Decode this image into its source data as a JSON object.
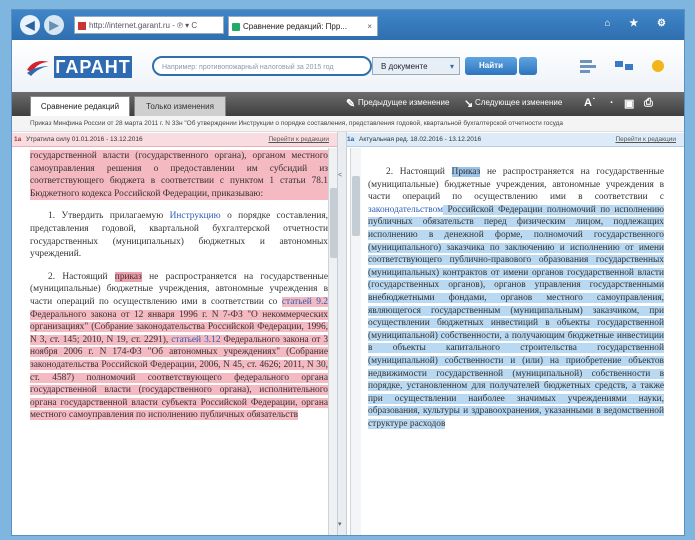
{
  "browser": {
    "address": "http://internet.garant.ru - ℗ ▾ C",
    "tab_title": "Сравнение редакций: Прр...",
    "window_buttons": "⌂ ★ ⚙"
  },
  "header": {
    "logo_text": "ГАРАНТ",
    "search_placeholder": "Например: противопожарный налоговый за 2015 год",
    "scope_value": "В документе",
    "find_button": "Найти"
  },
  "toolbar": {
    "tab_compare": "Сравнение редакций",
    "tab_text": "Только изменения",
    "prev_change": "Предыдущее изменение",
    "next_change": "Следующее изменение"
  },
  "info_line": "Приказ Минфина России от 28 марта 2011 г. N 33н \"Об утверждении Инструкции о порядке составления, представления годовой, квартальной бухгалтерской отчетности госуда",
  "left_edition": {
    "num": "1a",
    "label": "Утратила силу 01.01.2016 - 13.12.2016",
    "action": "Перейти к редакции"
  },
  "right_edition": {
    "num": "1a",
    "label": "Актуальная ред. 18.02.2016 - 13.12.2016",
    "action": "Перейти к редакции"
  },
  "left_text": {
    "p0": "государственной власти (государственного органа), органом местного самоуправления решения о предоставлении им субсидий из соответствующего бюджета в соответствии с пунктом 1 статьи 78.1 Бюджетного кодекса Российской Федерации, приказываю:",
    "p1_a": "1. Утвердить прилагаемую ",
    "p1_link": "Инструкцию",
    "p1_b": " о порядке составления, представления годовой, квартальной бухгалтерской отчетности государственных (муниципальных) бюджетных и автономных учреждений.",
    "p2_a": "2. Настоящий ",
    "p2_word": "приказ",
    "p2_b": " не распространяется на государственные (муниципальные) бюджетные учреждения, автономные учреждения в части операций по осуществлению ими в соответствии со ",
    "p2_link1": "статьей 9.2",
    "p2_c": " Федерального закона от 12 января 1996 г. N 7-ФЗ \"О некоммерческих организациях\" (Собрание законодательства Российской Федерации, 1996, N 3, ст. 145; 2010, N 19, ст. 2291), ",
    "p2_link2": "статьей 3.12",
    "p2_d": " Федерального закона от 3 ноября 2006 г. N 174-ФЗ \"Об автономных учреждениях\" (Собрание законодательства Российской Федерации, 2006, N 45, ст. 4626; 2011, N 30, ст. 4587) полномочий соответствующего федерального органа государственной власти (государственного органа), исполнительного органа государственной власти субъекта Российской Федерации, органа местного самоуправления по исполнению публичных обязательств"
  },
  "right_text": {
    "p0_a": "2. Настоящий ",
    "p0_word": "Приказ",
    "p0_b": " не распространяется на государственные (муниципальные) бюджетные учреждения, автономные учреждения в части операций по осуществлению ими в соответствии с ",
    "p0_link": "законодательством",
    "p0_c": " Российской Федерации полномочий по исполнению публичных обязательств перед физическим лицом, подлежащих исполнению в денежной форме, полномочий государственного (муниципального) заказчика по заключению и исполнению от имени соответствующего публично-правового образования государственных (муниципальных) контрактов от имени органов государственной власти (государственных органов), органов управления государственными внебюджетными фондами, органов местного самоуправления, являющегося государственным (муниципальным) заказчиком, при осуществлении бюджетных инвестиций в объекты государственной (муниципальной) собственности, а получающим бюджетные инвестиции в объекты капитального строительства государственной (муниципальной) собственности и (или) на приобретение объектов недвижимости государственной (муниципальной) собственности в порядке, установленном для получателей бюджетных средств, а также при осуществлении наиболее значимых учреждениями науки, образования, культуры и здравоохранения, указанными в ведомственной структуре расходов"
  }
}
